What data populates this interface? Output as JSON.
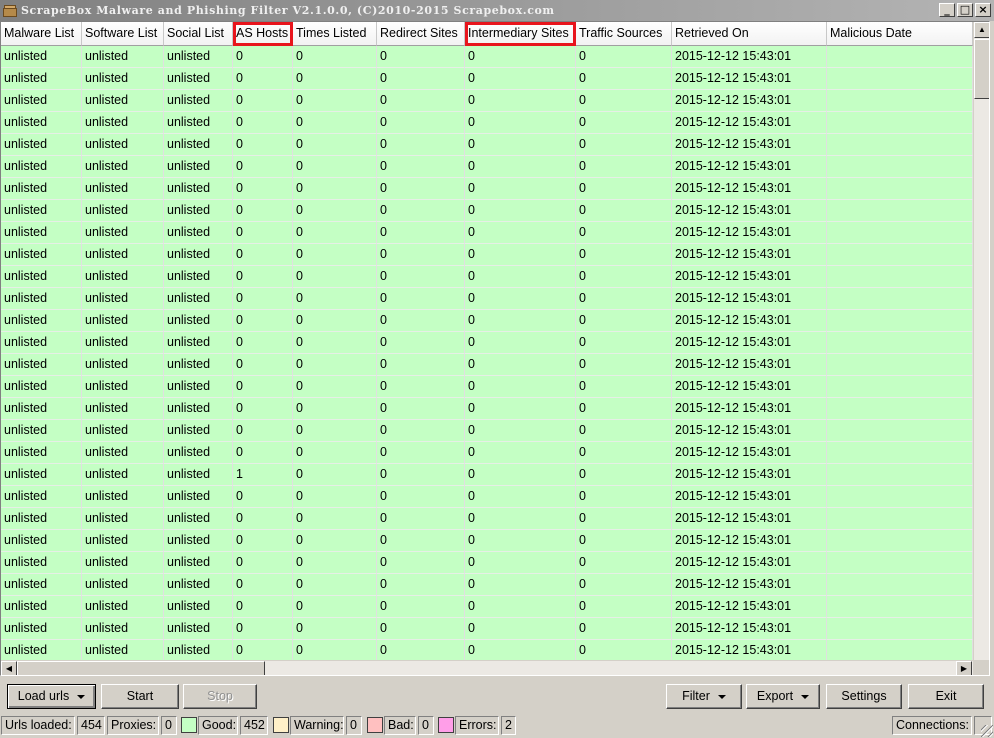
{
  "window": {
    "title": "ScrapeBox Malware and Phishing Filter V2.1.0.0, (C)2010-2015 Scrapebox.com"
  },
  "icons": {
    "app": "box-icon",
    "minimize": "minimize-icon",
    "maximize": "maximize-icon",
    "close": "close-icon"
  },
  "grid": {
    "columns": [
      "Malware List",
      "Software List",
      "Social List",
      "AS Hosts",
      "Times Listed",
      "Redirect Sites",
      "Intermediary Sites",
      "Traffic Sources",
      "Retrieved On",
      "Malicious Date"
    ],
    "highlighted_columns": [
      "AS Hosts",
      "Intermediary Sites"
    ],
    "row_color": "#c4ffc4",
    "rows": [
      [
        "unlisted",
        "unlisted",
        "unlisted",
        "0",
        "0",
        "0",
        "0",
        "0",
        "2015-12-12 15:43:01",
        ""
      ],
      [
        "unlisted",
        "unlisted",
        "unlisted",
        "0",
        "0",
        "0",
        "0",
        "0",
        "2015-12-12 15:43:01",
        ""
      ],
      [
        "unlisted",
        "unlisted",
        "unlisted",
        "0",
        "0",
        "0",
        "0",
        "0",
        "2015-12-12 15:43:01",
        ""
      ],
      [
        "unlisted",
        "unlisted",
        "unlisted",
        "0",
        "0",
        "0",
        "0",
        "0",
        "2015-12-12 15:43:01",
        ""
      ],
      [
        "unlisted",
        "unlisted",
        "unlisted",
        "0",
        "0",
        "0",
        "0",
        "0",
        "2015-12-12 15:43:01",
        ""
      ],
      [
        "unlisted",
        "unlisted",
        "unlisted",
        "0",
        "0",
        "0",
        "0",
        "0",
        "2015-12-12 15:43:01",
        ""
      ],
      [
        "unlisted",
        "unlisted",
        "unlisted",
        "0",
        "0",
        "0",
        "0",
        "0",
        "2015-12-12 15:43:01",
        ""
      ],
      [
        "unlisted",
        "unlisted",
        "unlisted",
        "0",
        "0",
        "0",
        "0",
        "0",
        "2015-12-12 15:43:01",
        ""
      ],
      [
        "unlisted",
        "unlisted",
        "unlisted",
        "0",
        "0",
        "0",
        "0",
        "0",
        "2015-12-12 15:43:01",
        ""
      ],
      [
        "unlisted",
        "unlisted",
        "unlisted",
        "0",
        "0",
        "0",
        "0",
        "0",
        "2015-12-12 15:43:01",
        ""
      ],
      [
        "unlisted",
        "unlisted",
        "unlisted",
        "0",
        "0",
        "0",
        "0",
        "0",
        "2015-12-12 15:43:01",
        ""
      ],
      [
        "unlisted",
        "unlisted",
        "unlisted",
        "0",
        "0",
        "0",
        "0",
        "0",
        "2015-12-12 15:43:01",
        ""
      ],
      [
        "unlisted",
        "unlisted",
        "unlisted",
        "0",
        "0",
        "0",
        "0",
        "0",
        "2015-12-12 15:43:01",
        ""
      ],
      [
        "unlisted",
        "unlisted",
        "unlisted",
        "0",
        "0",
        "0",
        "0",
        "0",
        "2015-12-12 15:43:01",
        ""
      ],
      [
        "unlisted",
        "unlisted",
        "unlisted",
        "0",
        "0",
        "0",
        "0",
        "0",
        "2015-12-12 15:43:01",
        ""
      ],
      [
        "unlisted",
        "unlisted",
        "unlisted",
        "0",
        "0",
        "0",
        "0",
        "0",
        "2015-12-12 15:43:01",
        ""
      ],
      [
        "unlisted",
        "unlisted",
        "unlisted",
        "0",
        "0",
        "0",
        "0",
        "0",
        "2015-12-12 15:43:01",
        ""
      ],
      [
        "unlisted",
        "unlisted",
        "unlisted",
        "0",
        "0",
        "0",
        "0",
        "0",
        "2015-12-12 15:43:01",
        ""
      ],
      [
        "unlisted",
        "unlisted",
        "unlisted",
        "0",
        "0",
        "0",
        "0",
        "0",
        "2015-12-12 15:43:01",
        ""
      ],
      [
        "unlisted",
        "unlisted",
        "unlisted",
        "1",
        "0",
        "0",
        "0",
        "0",
        "2015-12-12 15:43:01",
        ""
      ],
      [
        "unlisted",
        "unlisted",
        "unlisted",
        "0",
        "0",
        "0",
        "0",
        "0",
        "2015-12-12 15:43:01",
        ""
      ],
      [
        "unlisted",
        "unlisted",
        "unlisted",
        "0",
        "0",
        "0",
        "0",
        "0",
        "2015-12-12 15:43:01",
        ""
      ],
      [
        "unlisted",
        "unlisted",
        "unlisted",
        "0",
        "0",
        "0",
        "0",
        "0",
        "2015-12-12 15:43:01",
        ""
      ],
      [
        "unlisted",
        "unlisted",
        "unlisted",
        "0",
        "0",
        "0",
        "0",
        "0",
        "2015-12-12 15:43:01",
        ""
      ],
      [
        "unlisted",
        "unlisted",
        "unlisted",
        "0",
        "0",
        "0",
        "0",
        "0",
        "2015-12-12 15:43:01",
        ""
      ],
      [
        "unlisted",
        "unlisted",
        "unlisted",
        "0",
        "0",
        "0",
        "0",
        "0",
        "2015-12-12 15:43:01",
        ""
      ],
      [
        "unlisted",
        "unlisted",
        "unlisted",
        "0",
        "0",
        "0",
        "0",
        "0",
        "2015-12-12 15:43:01",
        ""
      ],
      [
        "unlisted",
        "unlisted",
        "unlisted",
        "0",
        "0",
        "0",
        "0",
        "0",
        "2015-12-12 15:43:01",
        ""
      ]
    ]
  },
  "toolbar": {
    "load_urls": "Load urls",
    "start": "Start",
    "stop": "Stop",
    "filter": "Filter",
    "export": "Export",
    "settings": "Settings",
    "exit": "Exit"
  },
  "status": {
    "urls_loaded_label": "Urls loaded:",
    "urls_loaded_value": "454",
    "proxies_label": "Proxies:",
    "proxies_value": "0",
    "good_label": "Good:",
    "good_value": "452",
    "good_color": "#c4ffc4",
    "warning_label": "Warning:",
    "warning_value": "0",
    "warning_color": "#fff0c8",
    "bad_label": "Bad:",
    "bad_value": "0",
    "bad_color": "#ffc0c0",
    "errors_label": "Errors:",
    "errors_value": "2",
    "errors_color": "#ff9ee8",
    "connections_label": "Connections:"
  }
}
